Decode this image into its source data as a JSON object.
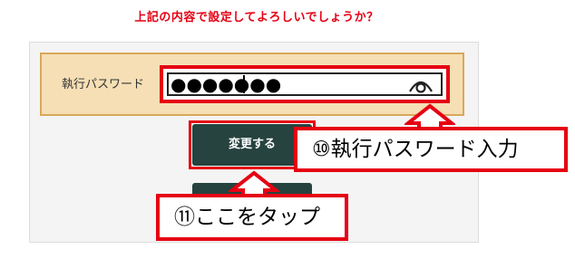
{
  "confirm_question": "上記の内容で設定してよろしいでしょうか？",
  "password_field": {
    "label": "執行パスワード",
    "masked_value": "●●●●●●●",
    "toggle_icon": "eye-icon"
  },
  "buttons": {
    "change_label": "変更する"
  },
  "annotations": {
    "step10": "⑩執行パスワード入力",
    "step11": "⑪ここをタップ"
  },
  "colors": {
    "accent_red": "#e60012",
    "button_green": "#26433f",
    "field_row_bg": "#f6dfb5"
  }
}
